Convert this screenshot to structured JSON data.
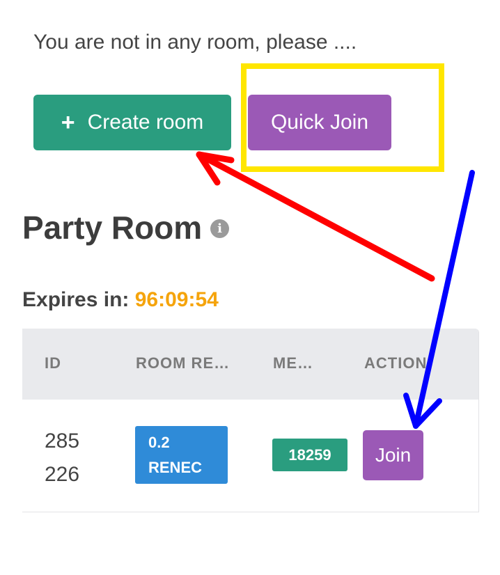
{
  "notice": "You are not in any room, please ....",
  "buttons": {
    "create_plus": "+",
    "create_label": "Create room",
    "quick_join_label": "Quick Join"
  },
  "section": {
    "title": "Party Room",
    "info_icon": "i"
  },
  "expires": {
    "label": "Expires in:",
    "value": "96:09:54"
  },
  "table": {
    "headers": [
      "ID",
      "ROOM RE…",
      "ME…",
      "ACTION"
    ],
    "rows": [
      {
        "id_line1": "285",
        "id_line2": "226",
        "reward_line1": "0.2",
        "reward_line2": "RENEC",
        "member": "18259",
        "action": "Join"
      }
    ]
  },
  "icons": {
    "create": "plus-icon",
    "info": "info-icon"
  },
  "colors": {
    "create_button": "#2a9d7f",
    "quick_join_button": "#9b59b6",
    "timer": "#f5a40c",
    "reward_badge": "#2f8bd8",
    "member_badge": "#2a9d7f",
    "annotation_box": "#ffe600",
    "annotation_red": "#ff0000",
    "annotation_blue": "#0000ff"
  }
}
